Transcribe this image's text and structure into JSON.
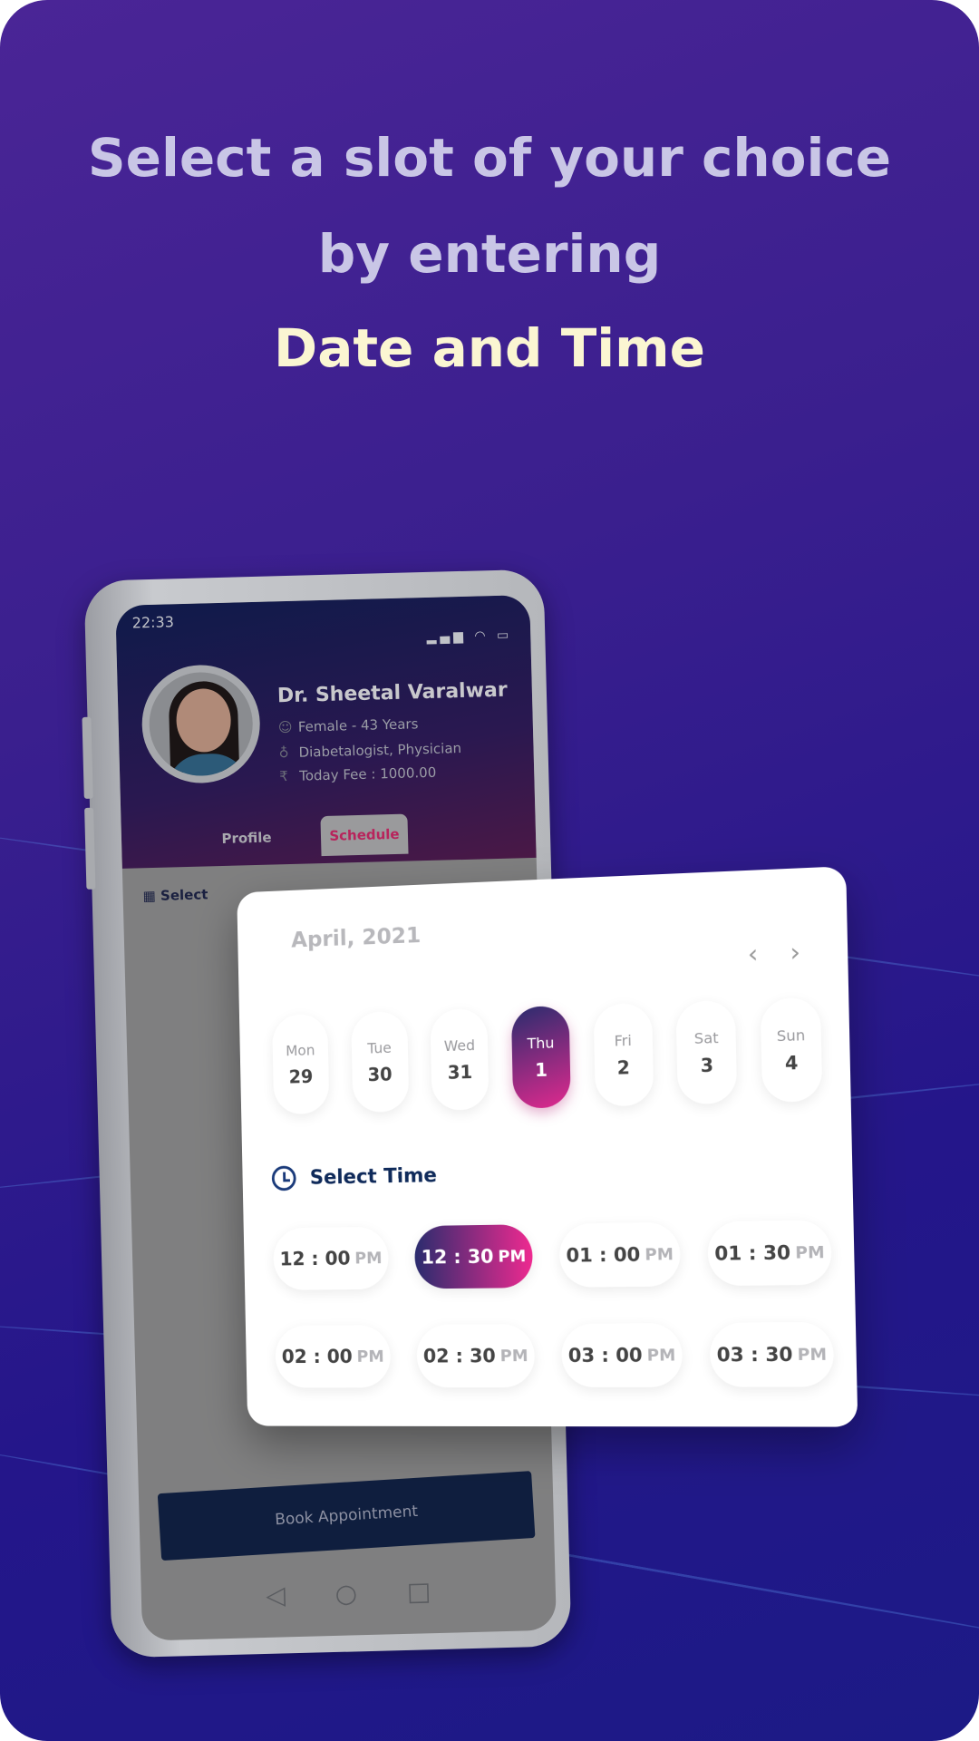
{
  "headline": {
    "line1": "Select a slot of your choice",
    "line2": "by entering",
    "line3": "Date and Time"
  },
  "phone": {
    "status_time": "22:33",
    "doctor": {
      "name": "Dr. Sheetal Varalwar",
      "gender_age": "Female - 43 Years",
      "specialty": "Diabetalogist, Physician",
      "fee": "Today Fee : 1000.00"
    },
    "tabs": [
      {
        "label": "Profile"
      },
      {
        "label": "Schedule",
        "active": true
      }
    ],
    "select_label": "Select",
    "book_button": "Book Appointment"
  },
  "calendar": {
    "month": "April, 2021",
    "days": [
      {
        "name": "Mon",
        "date": "29"
      },
      {
        "name": "Tue",
        "date": "30"
      },
      {
        "name": "Wed",
        "date": "31"
      },
      {
        "name": "Thu",
        "date": "1",
        "selected": true
      },
      {
        "name": "Fri",
        "date": "2"
      },
      {
        "name": "Sat",
        "date": "3"
      },
      {
        "name": "Sun",
        "date": "4"
      }
    ],
    "select_time_label": "Select Time",
    "slots": [
      {
        "time": "12 : 00",
        "period": "PM"
      },
      {
        "time": "12 : 30",
        "period": "PM",
        "selected": true
      },
      {
        "time": "01 : 00",
        "period": "PM"
      },
      {
        "time": "01 : 30",
        "period": "PM"
      },
      {
        "time": "02 : 00",
        "period": "PM"
      },
      {
        "time": "02 : 30",
        "period": "PM"
      },
      {
        "time": "03 : 00",
        "period": "PM"
      },
      {
        "time": "03 : 30",
        "period": "PM"
      }
    ]
  },
  "colors": {
    "accent_start": "#2a2c6e",
    "accent_end": "#ee2a90",
    "headline_highlight": "#fbf6d2"
  }
}
